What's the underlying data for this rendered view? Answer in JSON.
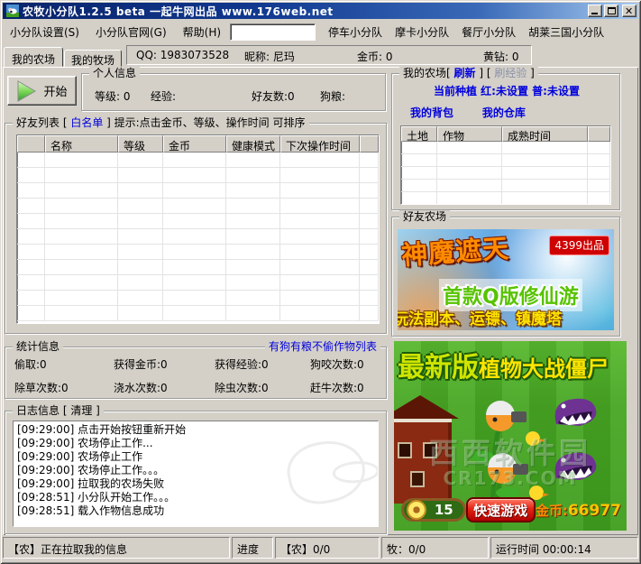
{
  "window": {
    "title": "农牧小分队1.2.5 beta 一起牛网出品 www.176web.net"
  },
  "menu": {
    "items": [
      "小分队设置(S)",
      "小分队官网(G)",
      "帮助(H)"
    ],
    "links": [
      "停车小分队",
      "摩卡小分队",
      "餐厅小分队",
      "胡莱三国小分队"
    ]
  },
  "tabs": {
    "farm": "我的农场",
    "ranch": "我的牧场"
  },
  "account": {
    "qq": "QQ: 1983073528",
    "nick": "昵称: 尼玛",
    "coin": "金币: 0",
    "diamond": "黄钻: 0"
  },
  "toolbar": {
    "start": "开始"
  },
  "personal": {
    "title": "个人信息",
    "level": "等级: 0",
    "exp": "经验:",
    "friends": "好友数:0",
    "dogfood": "狗粮:"
  },
  "friend_list": {
    "title_p1": "好友列表 [ ",
    "whitelist": "白名单",
    "title_p2": " ]  提示:点击金币、等级、操作时间 可排序",
    "columns": [
      "",
      "名称",
      "等级",
      "金币",
      "健康模式",
      "下次操作时间",
      ""
    ],
    "rows": 11
  },
  "stats": {
    "title": "统计信息",
    "link": "有狗有粮不偷作物列表",
    "items": [
      "偷取:0",
      "获得金币:0",
      "获得经验:0",
      "狗咬次数:0",
      "除草次数:0",
      "浇水次数:0",
      "除虫次数:0",
      "赶牛次数:0"
    ]
  },
  "log": {
    "title_p1": "日志信息 [ ",
    "clear": "清理",
    "title_p2": "  ]",
    "lines": [
      "[09:29:00] 点击开始按钮重新开始",
      "[09:29:00] 农场停止工作...",
      "[09:29:00] 农场停止工作",
      "[09:29:00] 农场停止工作。。。",
      "[09:29:00] 拉取我的农场失败",
      "[09:28:51] 小分队开始工作。。。",
      "[09:28:51] 载入作物信息成功"
    ]
  },
  "my_farm": {
    "title_p1": "我的农场[ ",
    "refresh": "刷新",
    "title_p2": " ]  [ ",
    "exp_refresh": "刷经验",
    "title_p3": " ]",
    "current_plant": "当前种植 红:未设置 普:未设置",
    "backpack": "我的背包",
    "warehouse": "我的仓库",
    "columns": [
      "土地",
      "作物",
      "成熟时间",
      ""
    ],
    "rows": 5
  },
  "friend_farm": {
    "title": "好友农场"
  },
  "ad_top": {
    "game_title": "神魔遮天",
    "badge": "4399出品",
    "slogan": "首款Q版修仙游",
    "features": "玩法副本、运镖、镇魔塔"
  },
  "ad_bottom": {
    "title_1": "最新版",
    "title_2": "植物大战僵尸",
    "watermark_1": "西西软件园",
    "watermark_2": "CR173.COM",
    "sun_count": "15",
    "play_button": "快速游戏",
    "coin_label": "金币:",
    "coin_value": "66977"
  },
  "statusbar": {
    "cells": [
      "【农】正在拉取我的信息",
      "进度",
      "【农】0/0",
      "牧：0/0",
      "运行时间  00:00:14"
    ]
  },
  "colors": {
    "titlebar_left": "#0a246a",
    "titlebar_right": "#a6caf0",
    "window_bg": "#d4d0c8",
    "link_blue": "#0000dd",
    "disabled_link": "#8a92a8",
    "ad_button_red": "#e22414",
    "coin_orange": "#ff8a00",
    "ad_green": "#47a623"
  }
}
